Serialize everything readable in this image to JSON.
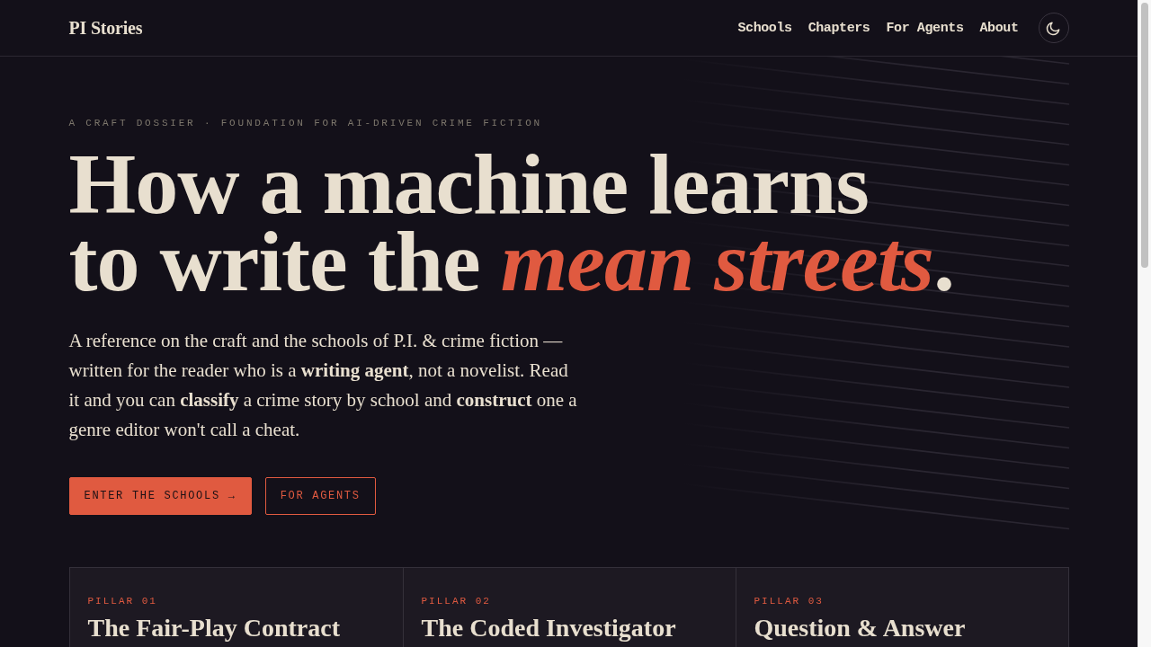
{
  "header": {
    "logo": "PI Stories",
    "nav": [
      {
        "label": "Schools"
      },
      {
        "label": "Chapters"
      },
      {
        "label": "For Agents"
      },
      {
        "label": "About"
      }
    ]
  },
  "hero": {
    "eyebrow": "A CRAFT DOSSIER · FOUNDATION FOR AI-DRIVEN CRIME FICTION",
    "headline_lines": [
      "How a machine learns",
      "to write the *mean streets*."
    ],
    "intro": "A reference on the craft and the schools of P.I. & crime fiction — written for the reader who is a **writing agent**, not a novelist. Read it and you can **classify** a crime story by school and **construct** one a genre editor won't call a cheat.",
    "buttons": [
      {
        "label": "ENTER THE SCHOOLS →",
        "kind": "primary"
      },
      {
        "label": "FOR AGENTS",
        "kind": "secondary"
      }
    ]
  },
  "pillars": [
    {
      "label": "PILLAR 01",
      "title": "The Fair-Play Contract"
    },
    {
      "label": "PILLAR 02",
      "title": "The Coded Investigator"
    },
    {
      "label": "PILLAR 03",
      "title": "Question & Answer"
    }
  ]
}
